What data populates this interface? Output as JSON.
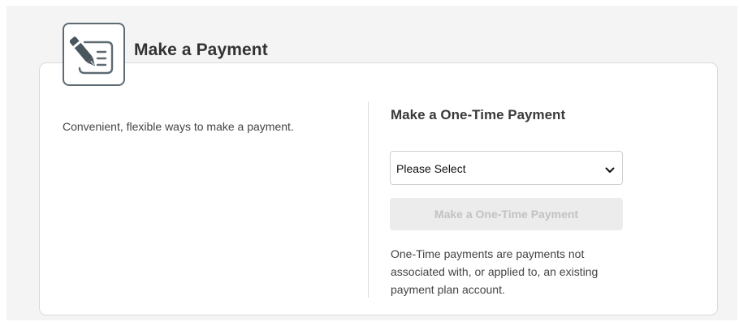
{
  "card": {
    "title": "Make a Payment",
    "icon": "payment-pen-icon",
    "description": "Convenient, flexible ways to make a payment."
  },
  "one_time": {
    "heading": "Make a One-Time Payment",
    "select": {
      "selected": "Please Select"
    },
    "button_label": "Make a One-Time Payment",
    "note": "One-Time payments are payments not associated with, or applied to, an existing payment plan account."
  },
  "colors": {
    "icon_stroke": "#5e6b73",
    "button_disabled_bg": "#ececec",
    "button_disabled_text": "#c2c2c2"
  }
}
